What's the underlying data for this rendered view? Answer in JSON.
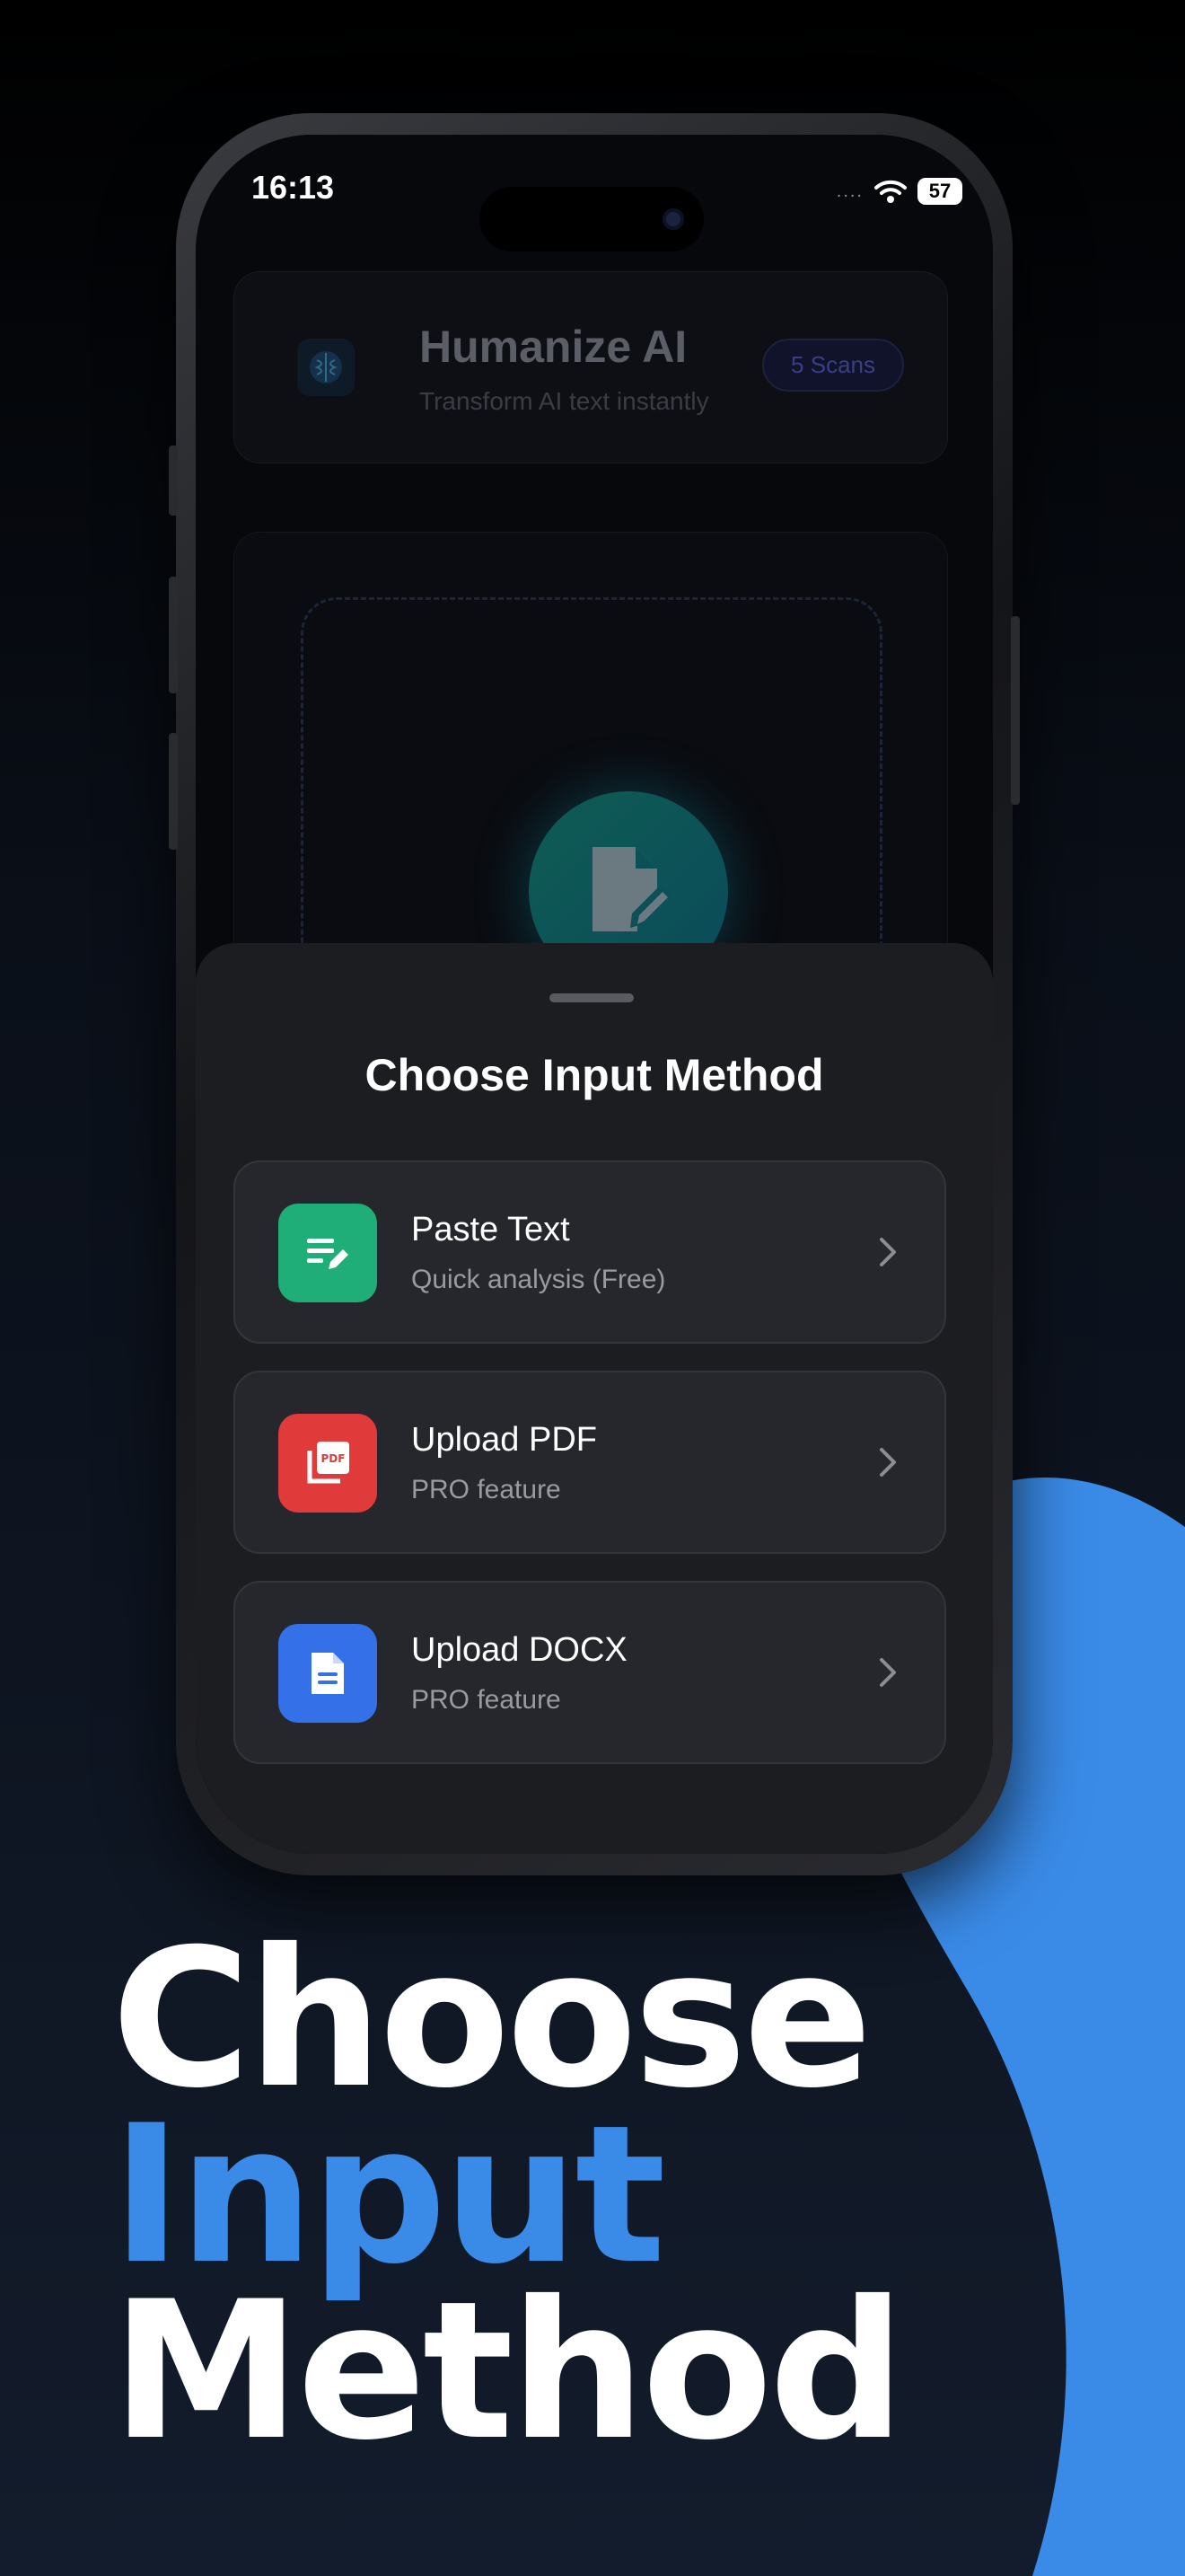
{
  "status_bar": {
    "time": "16:13",
    "signal": "....",
    "battery": "57"
  },
  "app_header": {
    "title": "Humanize AI",
    "subtitle": "Transform AI text instantly",
    "scans_badge": "5 Scans"
  },
  "sheet": {
    "title": "Choose Input Method",
    "options": [
      {
        "title": "Paste Text",
        "subtitle": "Quick analysis (Free)",
        "icon": "paste-text-icon",
        "color": "#1fae78"
      },
      {
        "title": "Upload PDF",
        "subtitle": "PRO feature",
        "icon": "pdf-icon",
        "color": "#e03a3a"
      },
      {
        "title": "Upload DOCX",
        "subtitle": "PRO feature",
        "icon": "docx-icon",
        "color": "#3470e8"
      }
    ]
  },
  "headline": {
    "line1": "Choose",
    "line2": "Input",
    "line3": "Method"
  },
  "colors": {
    "accent_blue": "#3a8be8",
    "background": "#0a0f18"
  }
}
